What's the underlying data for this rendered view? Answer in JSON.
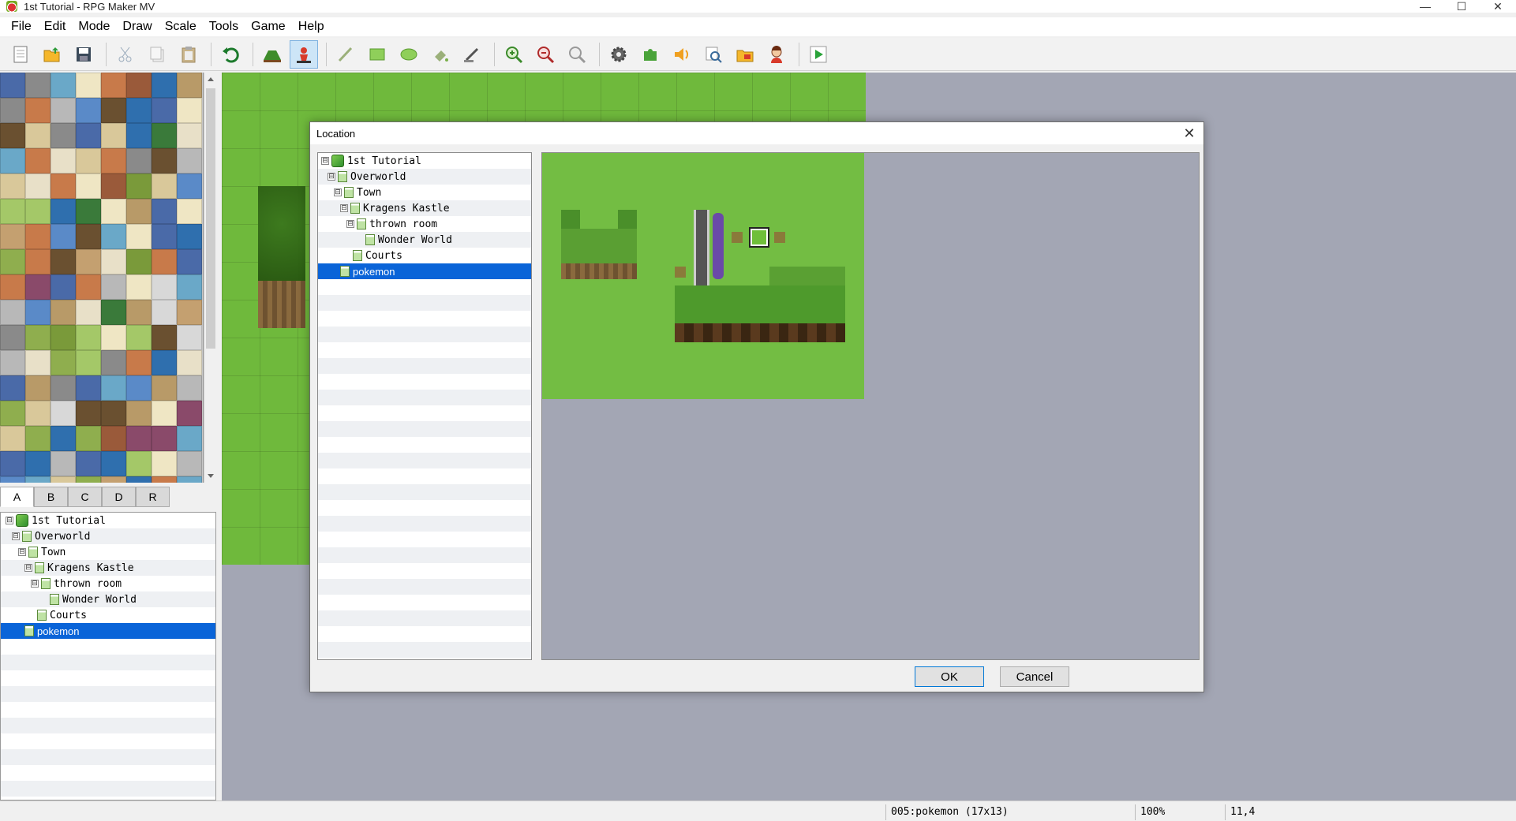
{
  "window": {
    "title": "1st Tutorial - RPG Maker MV",
    "controls": {
      "minimize": "—",
      "maximize": "☐",
      "close": "✕"
    }
  },
  "menu": [
    "File",
    "Edit",
    "Mode",
    "Draw",
    "Scale",
    "Tools",
    "Game",
    "Help"
  ],
  "toolbar": {
    "buttons": [
      "new-project",
      "open-project",
      "save-project",
      "cut",
      "copy",
      "paste",
      "undo",
      "map-mode",
      "event-mode",
      "pencil",
      "rectangle",
      "ellipse",
      "flood-fill",
      "shadow-pen",
      "zoom-in",
      "zoom-out",
      "actual-size",
      "database",
      "plugin-manager",
      "sound-test",
      "event-searcher",
      "resource-manager",
      "character-generator",
      "playtest"
    ]
  },
  "tileset_tabs": [
    "A",
    "B",
    "C",
    "D",
    "R"
  ],
  "selected_tab": "A",
  "map_tree": [
    {
      "label": "1st Tutorial",
      "depth": 0,
      "type": "root",
      "toggle": "⊟"
    },
    {
      "label": "Overworld",
      "depth": 1,
      "type": "map",
      "toggle": "⊟"
    },
    {
      "label": "Town",
      "depth": 2,
      "type": "map",
      "toggle": "⊟"
    },
    {
      "label": "Kragens Kastle",
      "depth": 3,
      "type": "map",
      "toggle": "⊟"
    },
    {
      "label": "thrown room",
      "depth": 4,
      "type": "map",
      "toggle": "⊟"
    },
    {
      "label": "Wonder World",
      "depth": 5,
      "type": "map",
      "toggle": ""
    },
    {
      "label": "Courts",
      "depth": 3,
      "type": "map",
      "toggle": ""
    },
    {
      "label": "pokemon",
      "depth": 1,
      "type": "map",
      "toggle": "",
      "selected": true
    }
  ],
  "dialog": {
    "title": "Location",
    "close": "✕",
    "ok": "OK",
    "cancel": "Cancel"
  },
  "status": {
    "map": "005:pokemon (17x13)",
    "zoom": "100%",
    "coords": "11,4"
  }
}
